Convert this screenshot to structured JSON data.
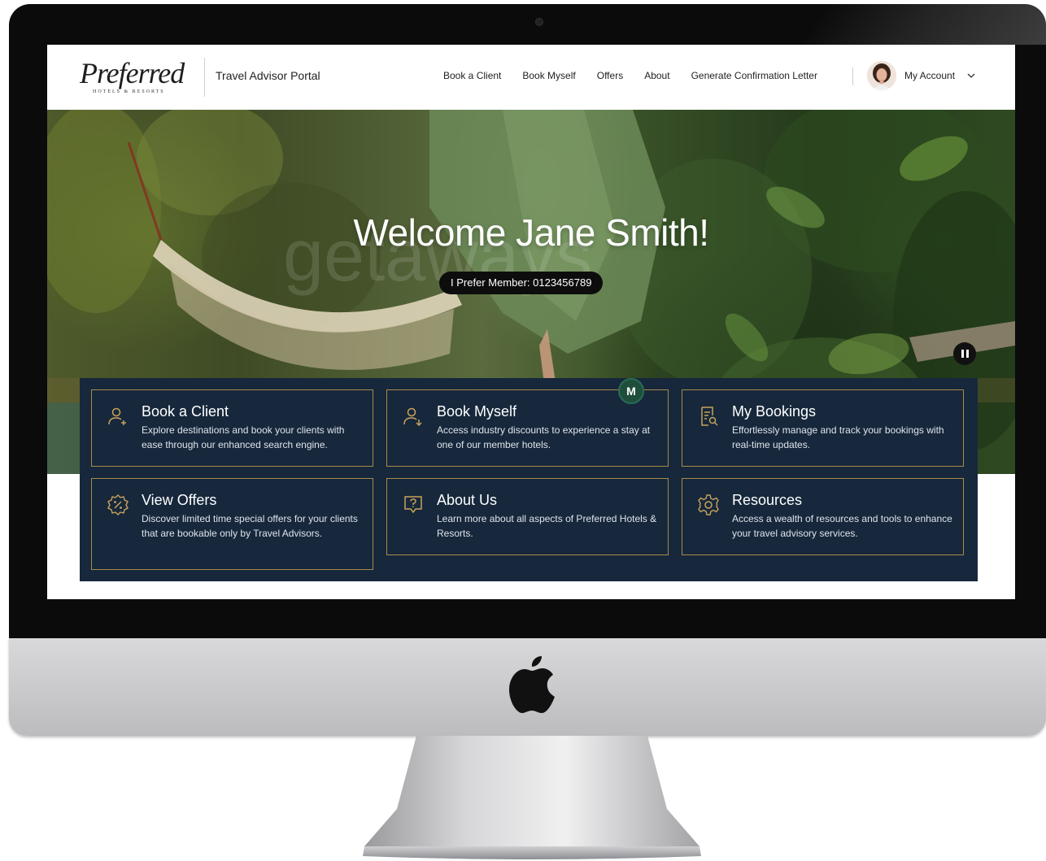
{
  "nav": {
    "logo_script": "Preferred",
    "logo_sub": "HOTELS & RESORTS",
    "portal_title": "Travel Advisor Portal",
    "links": [
      "Book a Client",
      "Book Myself",
      "Offers",
      "About",
      "Generate Confirmation Letter"
    ],
    "account_label": "My Account"
  },
  "hero": {
    "title": "Welcome Jane Smith!",
    "member_pill": "I Prefer Member: 0123456789"
  },
  "badge": {
    "letter": "M"
  },
  "cards": [
    {
      "title": "Book a Client",
      "description": "Explore destinations and book your clients with ease through our enhanced search engine.",
      "icon": "user-plus-icon"
    },
    {
      "title": "Book Myself",
      "description": "Access industry discounts to experience a stay at one of our member hotels.",
      "icon": "user-arrow-icon"
    },
    {
      "title": "My Bookings",
      "description": "Effortlessly manage and track your bookings with real-time updates.",
      "icon": "document-search-icon"
    },
    {
      "title": "View Offers",
      "description": "Discover limited time special offers for your clients that are bookable only by Travel Advisors.",
      "icon": "discount-badge-icon"
    },
    {
      "title": "About Us",
      "description": "Learn more about all aspects of Preferred Hotels & Resorts.",
      "icon": "question-bubble-icon"
    },
    {
      "title": "Resources",
      "description": "Access a wealth of resources and tools to enhance your travel advisory services.",
      "icon": "gear-icon"
    }
  ],
  "colors": {
    "card_panel": "#17283c",
    "card_border": "#a88a4a",
    "icon_gold": "#c9a35a",
    "badge_green": "#1f4e3d"
  }
}
